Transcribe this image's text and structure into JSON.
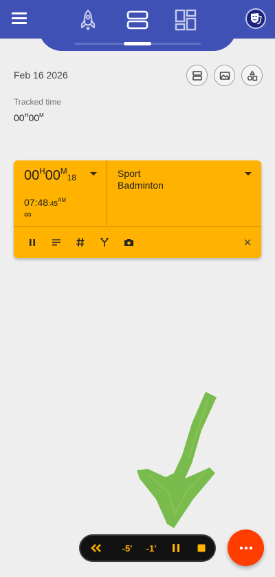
{
  "header": {
    "nav": [
      {
        "name": "rocket",
        "icon": "rocket-icon"
      },
      {
        "name": "stream",
        "icon": "stream-view-icon",
        "active": true
      },
      {
        "name": "dashboard",
        "icon": "dashboard-grid-icon"
      }
    ],
    "menu_icon": "hamburger-menu-icon",
    "profile_icon": "theater-masks-icon"
  },
  "date_row": {
    "date": "Feb 16 2026",
    "actions": [
      "stream-view-icon",
      "landscape-image-icon",
      "shapes-icon"
    ]
  },
  "summary": {
    "label": "Tracked time",
    "hours": "00",
    "hours_unit": "H",
    "minutes": "00",
    "minutes_unit": "M"
  },
  "timer_card": {
    "color": "#ffb300",
    "duration": {
      "hours": "00",
      "hours_unit": "H",
      "minutes": "00",
      "minutes_unit": "M",
      "seconds": "18"
    },
    "start": {
      "hm": "07:48",
      "seconds": ":45",
      "ampm": "AM"
    },
    "end": "∞",
    "category": "Sport",
    "activity": "Badminton",
    "actions": [
      "pause-icon",
      "notes-icon",
      "tags-icon",
      "split-icon",
      "camera-icon",
      "close-icon"
    ]
  },
  "controls": {
    "rewind_icon": "double-chevron-left-icon",
    "minus5": "-5'",
    "minus1": "-1'",
    "pause_icon": "pause-icon",
    "stop_icon": "stop-icon",
    "accent": "#ffb300"
  },
  "fab": {
    "icon": "more-dots-icon",
    "color": "#ff3d00"
  }
}
